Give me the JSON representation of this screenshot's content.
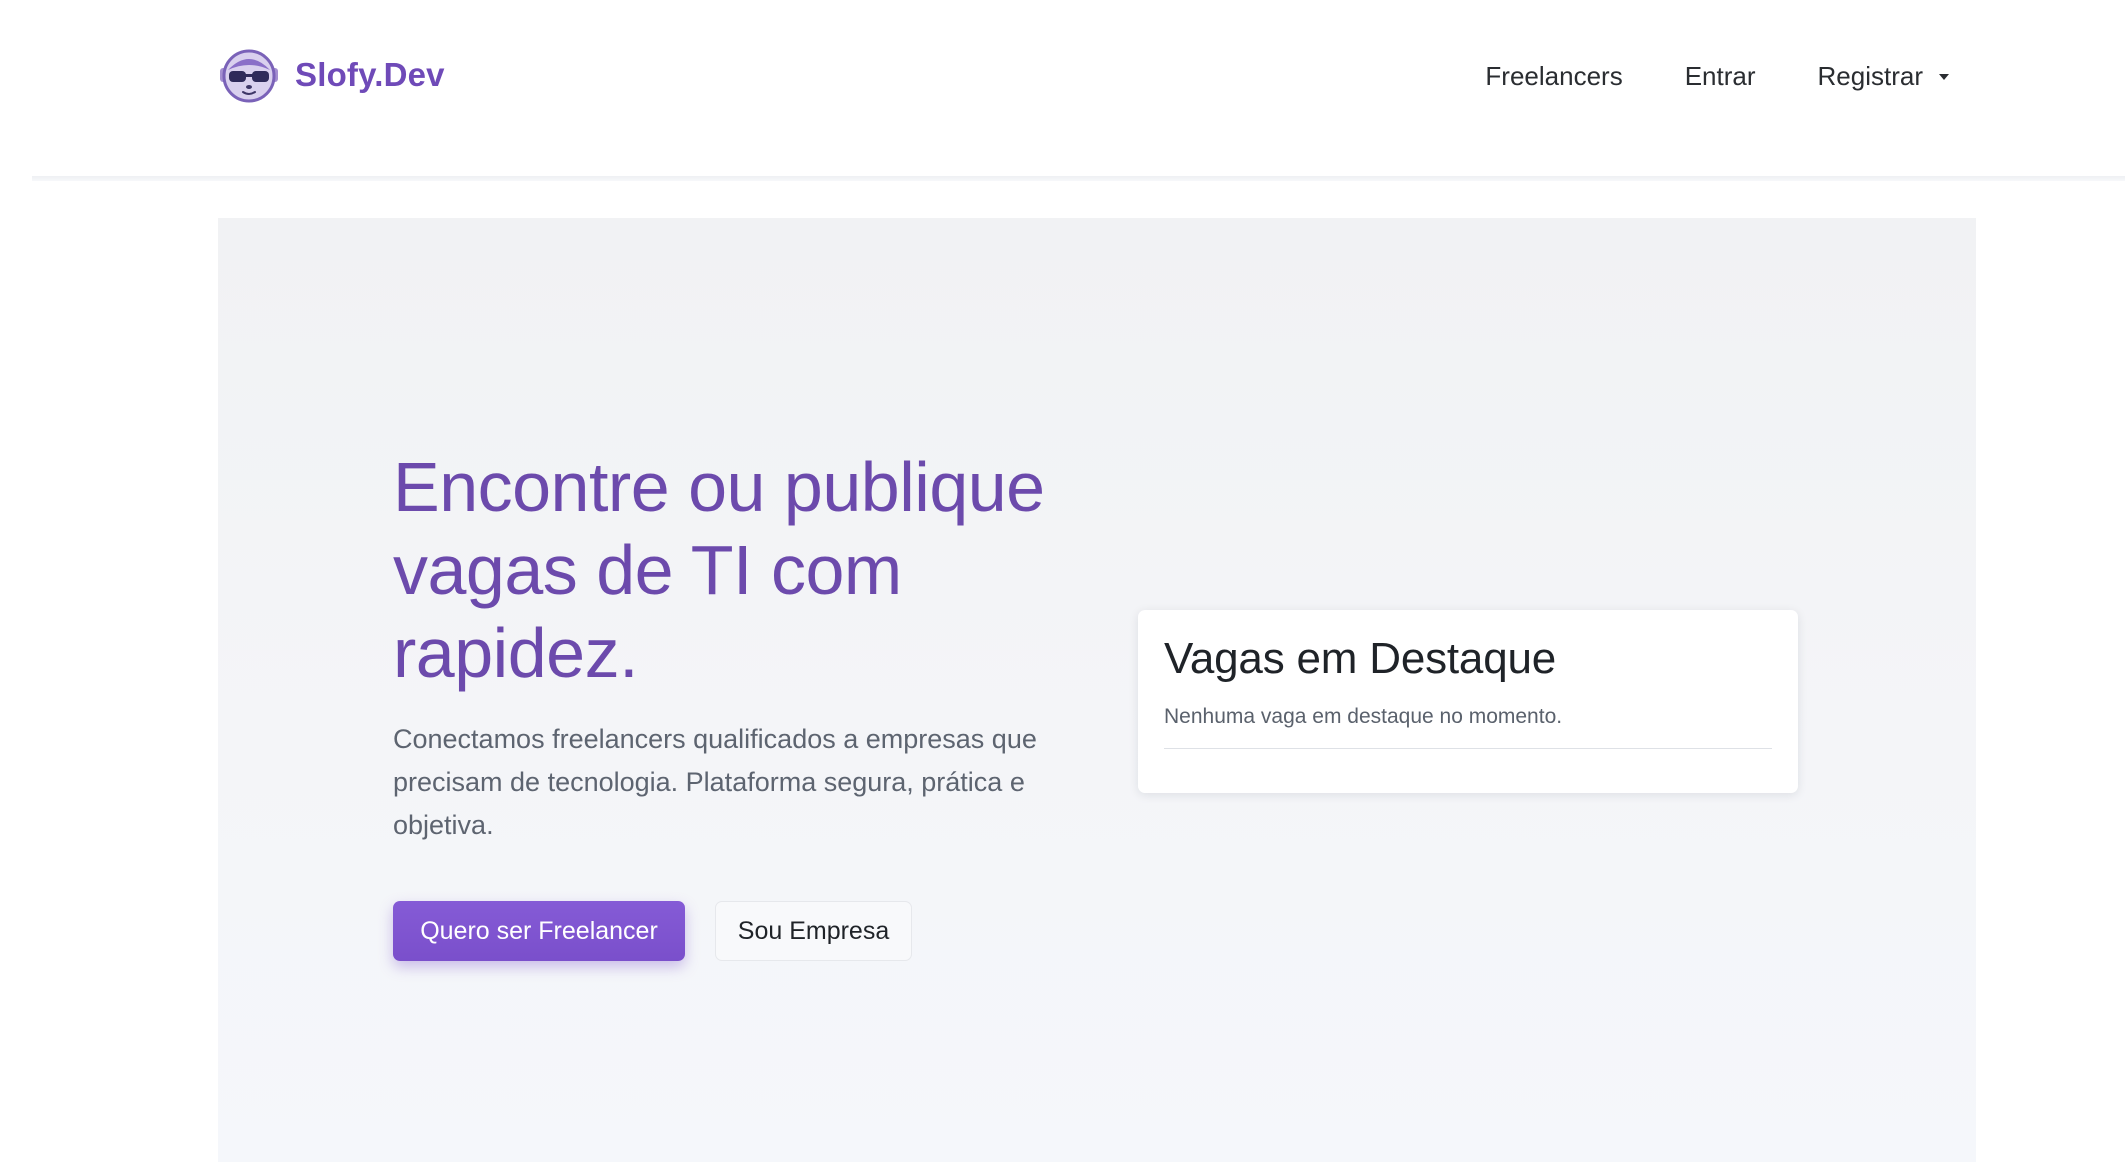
{
  "brand": {
    "name": "Slofy.Dev",
    "color": "#6f4ab8"
  },
  "nav": {
    "items": [
      {
        "label": "Freelancers"
      },
      {
        "label": "Entrar"
      },
      {
        "label": "Registrar",
        "has_dropdown": true
      }
    ]
  },
  "hero": {
    "title": "Encontre ou publique vagas de TI com rapidez.",
    "description": "Conectamos freelancers qualificados a empresas que precisam de tecnologia. Plataforma segura, prática e objetiva.",
    "primary_button": "Quero ser Freelancer",
    "secondary_button": "Sou Empresa",
    "accent_color": "#7a4fcb"
  },
  "featured": {
    "title": "Vagas em Destaque",
    "empty_message": "Nenhuma vaga em destaque no momento."
  }
}
